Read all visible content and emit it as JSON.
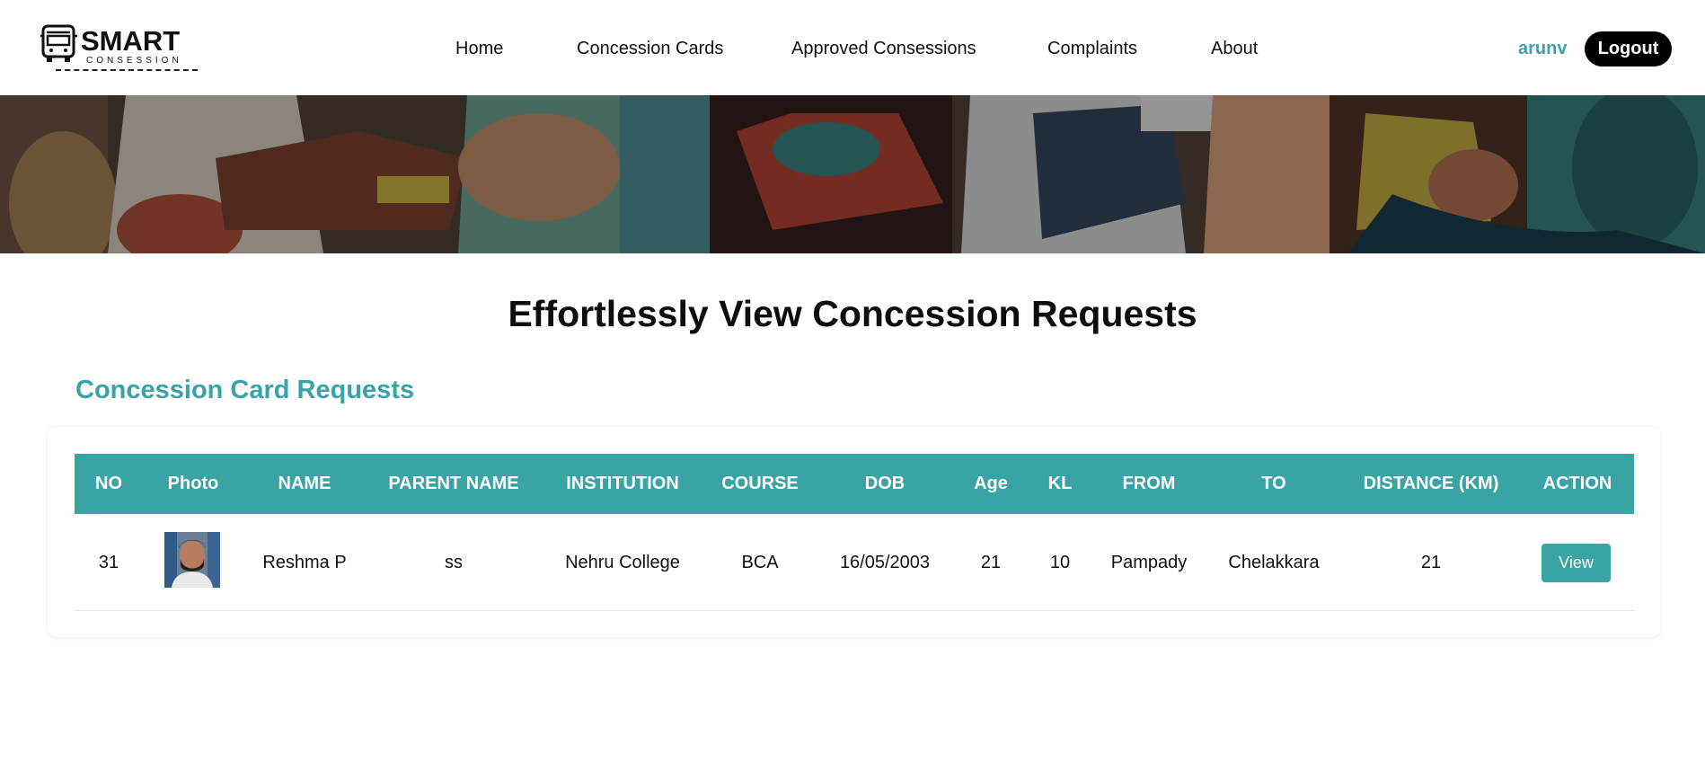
{
  "brand": {
    "name": "SMART",
    "tagline": "CONSESSION"
  },
  "nav": {
    "links": [
      "Home",
      "Concession Cards",
      "Approved Consessions",
      "Complaints",
      "About"
    ],
    "user": "arunv",
    "logout": "Logout"
  },
  "colors": {
    "accent": "#3aa3a5",
    "nav_button": "#000000"
  },
  "page": {
    "title": "Effortlessly View Concession Requests",
    "section_title": "Concession Card Requests"
  },
  "table": {
    "headers": [
      "NO",
      "Photo",
      "NAME",
      "PARENT NAME",
      "INSTITUTION",
      "COURSE",
      "DOB",
      "Age",
      "KL",
      "FROM",
      "TO",
      "DISTANCE (KM)",
      "ACTION"
    ],
    "rows": [
      {
        "no": "31",
        "photo_icon": "user-photo",
        "name": "Reshma P",
        "parent_name": "ss",
        "institution": "Nehru College",
        "course": "BCA",
        "dob": "16/05/2003",
        "age": "21",
        "kl": "10",
        "from": "Pampady",
        "to": "Chelakkara",
        "distance": "21",
        "action": "View"
      }
    ]
  }
}
